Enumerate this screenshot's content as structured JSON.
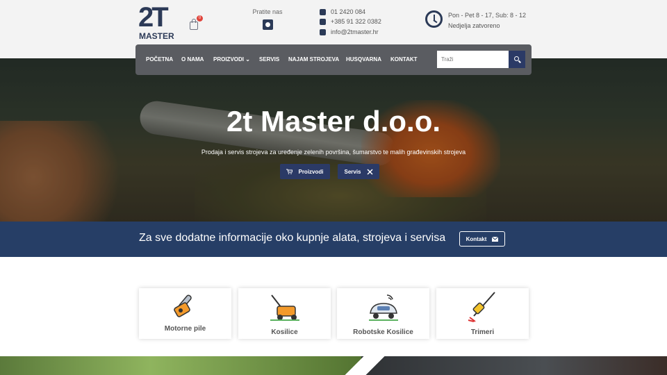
{
  "header": {
    "logo_big": "2T",
    "logo_small": "MASTER",
    "cart_count": "0",
    "follow_label": "Pratite nas",
    "phone1": "01 2420 084",
    "phone2": "+385 91 322 0382",
    "email": "info@2tmaster.hr",
    "hours1": "Pon - Pet 8 - 17, Sub: 8 - 12",
    "hours2": "Nedjelja zatvoreno"
  },
  "nav": {
    "items": [
      "POČETNA",
      "O NAMA",
      "PROIZVODI",
      "SERVIS",
      "NAJAM STROJEVA",
      "HUSQVARNA",
      "KONTAKT"
    ],
    "search_placeholder": "Traži"
  },
  "hero": {
    "title": "2t Master d.o.o.",
    "subtitle": "Prodaja i servis strojeva za uređenje zelenih površina, šumarstvo te malih građevinskih strojeva",
    "btn_products": "Proizvodi",
    "btn_service": "Servis"
  },
  "strip": {
    "text": "Za sve dodatne informacije oko kupnje alata, strojeva i servisa",
    "button": "Kontakt"
  },
  "categories": [
    "Motorne pile",
    "Kosilice",
    "Robotske Kosilice",
    "Trimeri"
  ],
  "colors": {
    "navy": "#263e66",
    "nav_bg": "#5a5c61",
    "accent_orange": "#e8862a"
  }
}
